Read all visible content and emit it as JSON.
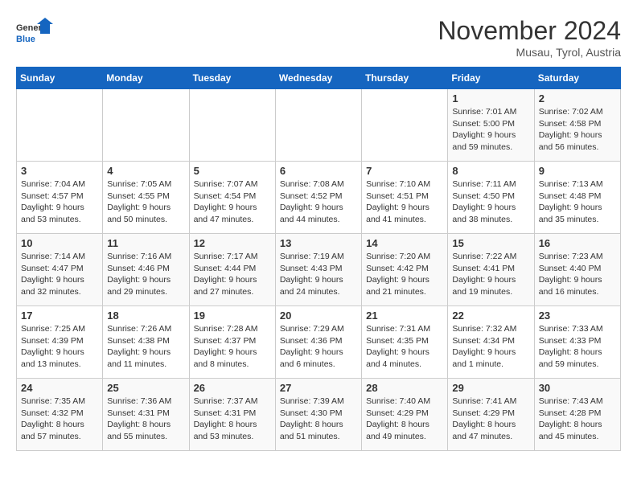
{
  "logo": {
    "general": "General",
    "blue": "Blue"
  },
  "header": {
    "month_year": "November 2024",
    "location": "Musau, Tyrol, Austria"
  },
  "weekdays": [
    "Sunday",
    "Monday",
    "Tuesday",
    "Wednesday",
    "Thursday",
    "Friday",
    "Saturday"
  ],
  "weeks": [
    [
      {
        "day": "",
        "info": ""
      },
      {
        "day": "",
        "info": ""
      },
      {
        "day": "",
        "info": ""
      },
      {
        "day": "",
        "info": ""
      },
      {
        "day": "",
        "info": ""
      },
      {
        "day": "1",
        "info": "Sunrise: 7:01 AM\nSunset: 5:00 PM\nDaylight: 9 hours and 59 minutes."
      },
      {
        "day": "2",
        "info": "Sunrise: 7:02 AM\nSunset: 4:58 PM\nDaylight: 9 hours and 56 minutes."
      }
    ],
    [
      {
        "day": "3",
        "info": "Sunrise: 7:04 AM\nSunset: 4:57 PM\nDaylight: 9 hours and 53 minutes."
      },
      {
        "day": "4",
        "info": "Sunrise: 7:05 AM\nSunset: 4:55 PM\nDaylight: 9 hours and 50 minutes."
      },
      {
        "day": "5",
        "info": "Sunrise: 7:07 AM\nSunset: 4:54 PM\nDaylight: 9 hours and 47 minutes."
      },
      {
        "day": "6",
        "info": "Sunrise: 7:08 AM\nSunset: 4:52 PM\nDaylight: 9 hours and 44 minutes."
      },
      {
        "day": "7",
        "info": "Sunrise: 7:10 AM\nSunset: 4:51 PM\nDaylight: 9 hours and 41 minutes."
      },
      {
        "day": "8",
        "info": "Sunrise: 7:11 AM\nSunset: 4:50 PM\nDaylight: 9 hours and 38 minutes."
      },
      {
        "day": "9",
        "info": "Sunrise: 7:13 AM\nSunset: 4:48 PM\nDaylight: 9 hours and 35 minutes."
      }
    ],
    [
      {
        "day": "10",
        "info": "Sunrise: 7:14 AM\nSunset: 4:47 PM\nDaylight: 9 hours and 32 minutes."
      },
      {
        "day": "11",
        "info": "Sunrise: 7:16 AM\nSunset: 4:46 PM\nDaylight: 9 hours and 29 minutes."
      },
      {
        "day": "12",
        "info": "Sunrise: 7:17 AM\nSunset: 4:44 PM\nDaylight: 9 hours and 27 minutes."
      },
      {
        "day": "13",
        "info": "Sunrise: 7:19 AM\nSunset: 4:43 PM\nDaylight: 9 hours and 24 minutes."
      },
      {
        "day": "14",
        "info": "Sunrise: 7:20 AM\nSunset: 4:42 PM\nDaylight: 9 hours and 21 minutes."
      },
      {
        "day": "15",
        "info": "Sunrise: 7:22 AM\nSunset: 4:41 PM\nDaylight: 9 hours and 19 minutes."
      },
      {
        "day": "16",
        "info": "Sunrise: 7:23 AM\nSunset: 4:40 PM\nDaylight: 9 hours and 16 minutes."
      }
    ],
    [
      {
        "day": "17",
        "info": "Sunrise: 7:25 AM\nSunset: 4:39 PM\nDaylight: 9 hours and 13 minutes."
      },
      {
        "day": "18",
        "info": "Sunrise: 7:26 AM\nSunset: 4:38 PM\nDaylight: 9 hours and 11 minutes."
      },
      {
        "day": "19",
        "info": "Sunrise: 7:28 AM\nSunset: 4:37 PM\nDaylight: 9 hours and 8 minutes."
      },
      {
        "day": "20",
        "info": "Sunrise: 7:29 AM\nSunset: 4:36 PM\nDaylight: 9 hours and 6 minutes."
      },
      {
        "day": "21",
        "info": "Sunrise: 7:31 AM\nSunset: 4:35 PM\nDaylight: 9 hours and 4 minutes."
      },
      {
        "day": "22",
        "info": "Sunrise: 7:32 AM\nSunset: 4:34 PM\nDaylight: 9 hours and 1 minute."
      },
      {
        "day": "23",
        "info": "Sunrise: 7:33 AM\nSunset: 4:33 PM\nDaylight: 8 hours and 59 minutes."
      }
    ],
    [
      {
        "day": "24",
        "info": "Sunrise: 7:35 AM\nSunset: 4:32 PM\nDaylight: 8 hours and 57 minutes."
      },
      {
        "day": "25",
        "info": "Sunrise: 7:36 AM\nSunset: 4:31 PM\nDaylight: 8 hours and 55 minutes."
      },
      {
        "day": "26",
        "info": "Sunrise: 7:37 AM\nSunset: 4:31 PM\nDaylight: 8 hours and 53 minutes."
      },
      {
        "day": "27",
        "info": "Sunrise: 7:39 AM\nSunset: 4:30 PM\nDaylight: 8 hours and 51 minutes."
      },
      {
        "day": "28",
        "info": "Sunrise: 7:40 AM\nSunset: 4:29 PM\nDaylight: 8 hours and 49 minutes."
      },
      {
        "day": "29",
        "info": "Sunrise: 7:41 AM\nSunset: 4:29 PM\nDaylight: 8 hours and 47 minutes."
      },
      {
        "day": "30",
        "info": "Sunrise: 7:43 AM\nSunset: 4:28 PM\nDaylight: 8 hours and 45 minutes."
      }
    ]
  ]
}
